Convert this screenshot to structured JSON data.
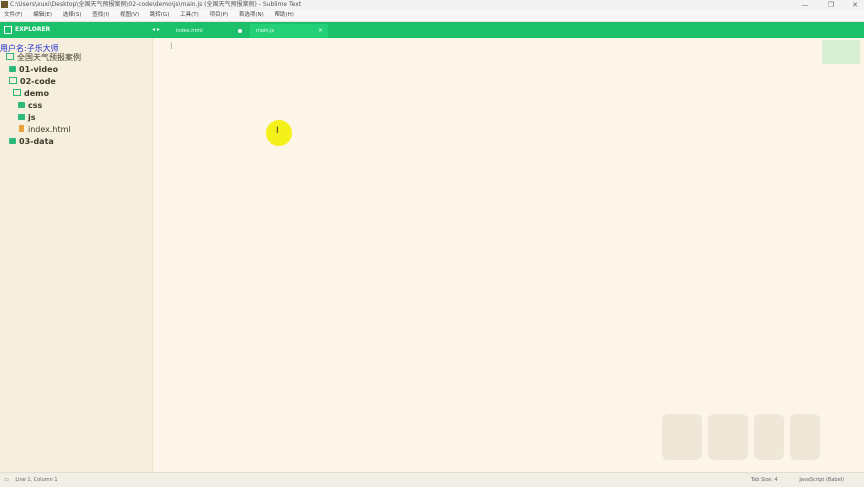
{
  "window": {
    "title": "C:\\Users\\xuxi\\Desktop\\全国天气预报案例\\02-code\\demo\\js\\main.js (全国天气预报案例) - Sublime Text",
    "controls": [
      "—",
      "❐",
      "✕"
    ]
  },
  "menu": [
    "文件(F)",
    "编辑(E)",
    "选择(S)",
    "查找(I)",
    "视图(V)",
    "跳转(G)",
    "工具(T)",
    "项目(P)",
    "首选项(N)",
    "帮助(H)"
  ],
  "header": {
    "explorer_label": "EXPLORER",
    "nav_arrows": "◂ ▸",
    "tabs": [
      {
        "label": "index.html",
        "active": false
      },
      {
        "label": "main.js",
        "active": true
      }
    ],
    "close_glyph": "×"
  },
  "sidebar": {
    "overlay_user": "用户名:子乐大师",
    "project": "全国天气预报案例",
    "items": [
      {
        "label": "01-video",
        "type": "folder"
      },
      {
        "label": "02-code",
        "type": "folder-open"
      },
      {
        "label": "demo",
        "type": "folder-open"
      },
      {
        "label": "css",
        "type": "folder"
      },
      {
        "label": "js",
        "type": "folder"
      },
      {
        "label": "index.html",
        "type": "file"
      },
      {
        "label": "03-data",
        "type": "folder"
      }
    ]
  },
  "editor": {
    "caret": "I",
    "cursor": "I"
  },
  "status": {
    "left": [
      "Line 1, Column 1"
    ],
    "tab_size": "Tab Size: 4",
    "syntax": "JavaScript (Babel)"
  }
}
